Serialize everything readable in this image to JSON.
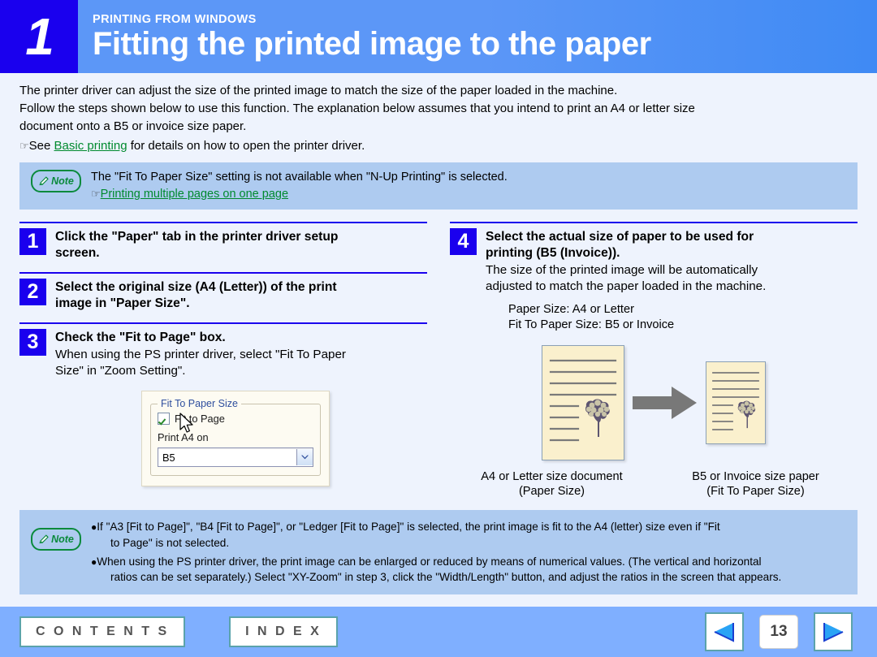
{
  "header": {
    "number": "1",
    "eyebrow": "PRINTING FROM WINDOWS",
    "title": "Fitting the printed image to the paper"
  },
  "intro": {
    "line1": "The printer driver can adjust the size of the printed image to match the size of the paper loaded in the machine.",
    "line2": "Follow the steps shown below to use this function. The explanation below assumes that you intend to print an A4 or letter size",
    "line3": "document onto a B5 or invoice size paper.",
    "see_prefix": "See ",
    "see_link": "Basic printing",
    "see_suffix": " for details on how to open the printer driver."
  },
  "note_top": {
    "badge": "Note",
    "text": "The \"Fit To Paper Size\" setting is not available when \"N-Up Printing\" is selected.",
    "link": "Printing multiple pages on one page"
  },
  "steps": {
    "step1": {
      "num": "1",
      "title_line1": "Click the \"Paper\" tab in the printer driver setup",
      "title_line2": "screen."
    },
    "step2": {
      "num": "2",
      "title_line1": "Select the original size (A4 (Letter)) of the print",
      "title_line2": "image in \"Paper Size\"."
    },
    "step3": {
      "num": "3",
      "title": "Check the \"Fit to Page\" box.",
      "desc_line1": "When using the PS printer driver, select \"Fit To Paper",
      "desc_line2": "Size\" in \"Zoom Setting\"."
    },
    "step4": {
      "num": "4",
      "title_line1": "Select the actual size of paper to be used for",
      "title_line2": "printing (B5 (Invoice)).",
      "desc_line1": "The size of the printed image will be automatically",
      "desc_line2": "adjusted to match the paper loaded in the machine.",
      "sub_line1": "Paper Size: A4 or Letter",
      "sub_line2": "Fit To Paper Size: B5 or Invoice"
    }
  },
  "dialog": {
    "group_label": "Fit To Paper Size",
    "checkbox_label": "Fit to Page",
    "checkbox_checked": "true",
    "print_on_label": "Print A4 on",
    "combo_value": "B5"
  },
  "illustration": {
    "left_caption_line1": "A4 or Letter size document",
    "left_caption_line2": "(Paper Size)",
    "right_caption_line1": "B5 or Invoice size paper",
    "right_caption_line2": "(Fit To Paper Size)"
  },
  "note_bottom": {
    "badge": "Note",
    "bullet1_line1": "If \"A3 [Fit to Page]\", \"B4 [Fit to Page]\", or \"Ledger [Fit to Page]\" is selected, the print image is fit to the A4 (letter) size even if \"Fit",
    "bullet1_line2": "to Page\" is not selected.",
    "bullet2_line1": "When using the PS printer driver, the print image can be enlarged or reduced by means of numerical values. (The vertical and horizontal",
    "bullet2_line2": "ratios can be set separately.) Select \"XY-Zoom\" in step 3, click the \"Width/Length\" button, and adjust the ratios in the screen that appears."
  },
  "footer": {
    "contents_label": "C O N T E N T S",
    "index_label": "I N D E X",
    "page_number": "13"
  },
  "colors": {
    "header_blue": "#5c97f7",
    "number_blue": "#1a00ee",
    "note_blue": "#aecbf0",
    "page_bg": "#eef3fd",
    "footer_blue": "#7fafff",
    "link_green": "#008a2e",
    "paper_cream": "#faf0cd",
    "button_teal": "#5ba3ab"
  }
}
